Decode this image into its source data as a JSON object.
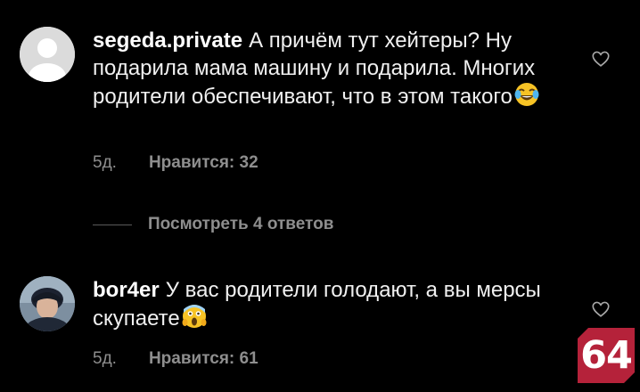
{
  "comments": [
    {
      "username": "segeda.private",
      "text": "А причём тут хейтеры? Ну подарила мама машину и подарила. Многих родители обеспечивают, что в этом такого",
      "emoji": "face-with-tears-of-joy",
      "time": "5д.",
      "likes": "Нравится: 32",
      "avatar": "default-avatar"
    },
    {
      "username": "bor4er",
      "text": "У вас родители голодают, а вы мерсы скупаете",
      "emoji": "face-screaming-in-fear",
      "time": "5д.",
      "likes": "Нравится: 61",
      "avatar": "user-photo-avatar"
    }
  ],
  "view_replies": "Посмотреть 4 ответов",
  "badge": {
    "text": "64",
    "color": "#b5223a"
  },
  "colors": {
    "background": "#000000",
    "meta": "#8e8e8e",
    "text": "#f0f0f0"
  }
}
